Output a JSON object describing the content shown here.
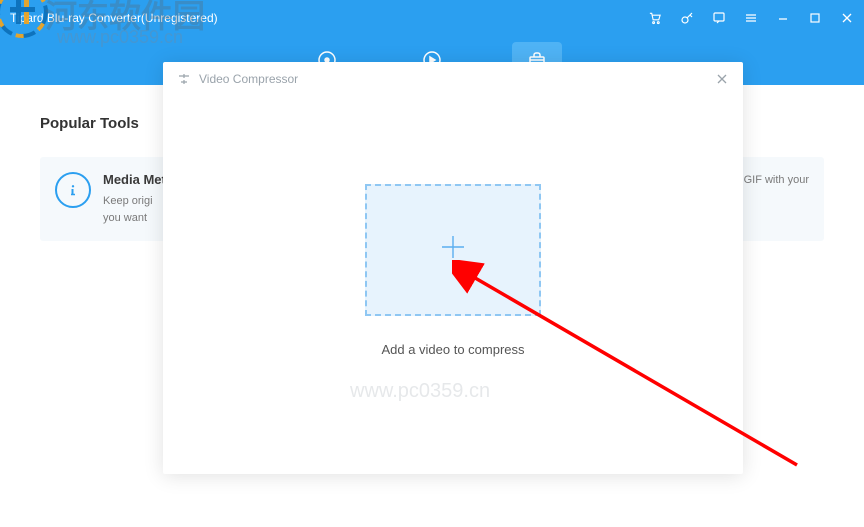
{
  "app": {
    "title": "Tipard Blu-ray Converter(Unregistered)"
  },
  "section": {
    "popular_tools": "Popular Tools"
  },
  "tools": {
    "media": {
      "title": "Media Met",
      "desc_line1": "Keep origi",
      "desc_line2": "you want"
    },
    "gif": {
      "desc_fragment": "mized GIF with your"
    }
  },
  "modal": {
    "title": "Video Compressor",
    "drop_label": "Add a video to compress"
  },
  "watermark": {
    "cn": "河东软件园",
    "url": "www.pc0359.cn"
  }
}
